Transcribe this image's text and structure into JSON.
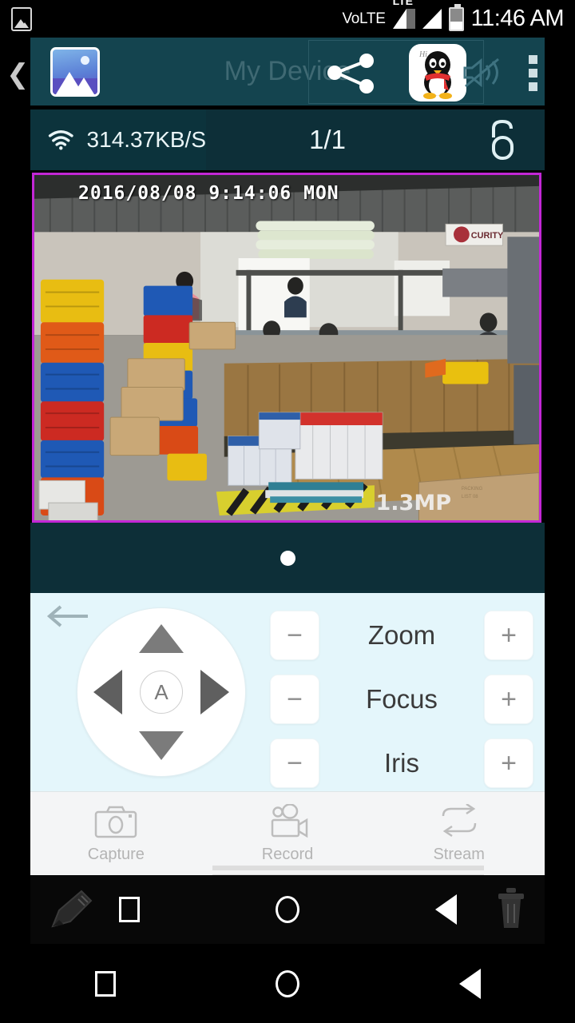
{
  "status_bar": {
    "gallery_icon": "image-icon",
    "network_label": "VoLTE",
    "lte_label": "LTE",
    "signal_icon": "signal-bars-icon",
    "battery_icon": "battery-icon",
    "clock": "11:46 AM"
  },
  "title_bar": {
    "back_icon": "chevron-left-icon",
    "gallery_overlay_icon": "gallery-app-icon",
    "title": "My Device",
    "share_icon": "share-icon",
    "qq_icon": "qq-penguin-icon",
    "qq_badge": "Hi",
    "mute_icon": "speaker-muted-icon",
    "menu_icon": "overflow-menu-icon"
  },
  "info_bar": {
    "wifi_icon": "wifi-icon",
    "bitrate": "314.37KB/S",
    "channel_ratio": "1/1",
    "lock_icon": "unlock-icon"
  },
  "video": {
    "timestamp": "2016/08/08 9:14:06 MON",
    "watermark": "1.3MP",
    "border_color": "#c327d6",
    "sign_text": "SECURITY"
  },
  "pager": {
    "dots": 1,
    "active": 0
  },
  "ptz": {
    "back_arrow_icon": "arrow-left-icon",
    "dpad": {
      "up_icon": "triangle-up-icon",
      "down_icon": "triangle-down-icon",
      "left_icon": "triangle-left-icon",
      "right_icon": "triangle-right-icon",
      "auto_label": "A"
    },
    "lens_controls": [
      {
        "label": "Zoom",
        "minus": "−",
        "plus": "+"
      },
      {
        "label": "Focus",
        "minus": "−",
        "plus": "+"
      },
      {
        "label": "Iris",
        "minus": "−",
        "plus": "+"
      }
    ]
  },
  "toolbar": [
    {
      "label": "Capture",
      "icon": "camera-icon"
    },
    {
      "label": "Record",
      "icon": "video-camera-icon"
    },
    {
      "label": "Stream",
      "icon": "swap-arrows-icon"
    }
  ],
  "nav_overlay": {
    "pencil_icon": "pencil-icon",
    "recents_icon": "square-icon",
    "home_icon": "circle-icon",
    "back_icon": "triangle-back-icon",
    "trash_icon": "trash-icon"
  },
  "system_nav": {
    "recents_icon": "square-icon",
    "home_icon": "circle-icon",
    "back_icon": "triangle-back-icon"
  },
  "colors": {
    "title_bar_bg": "#14444f",
    "info_bar_bg": "#0d2f38",
    "panel_bg": "#e4f6fb",
    "toolbar_bg": "#f4f5f6",
    "accent_border": "#c327d6"
  }
}
